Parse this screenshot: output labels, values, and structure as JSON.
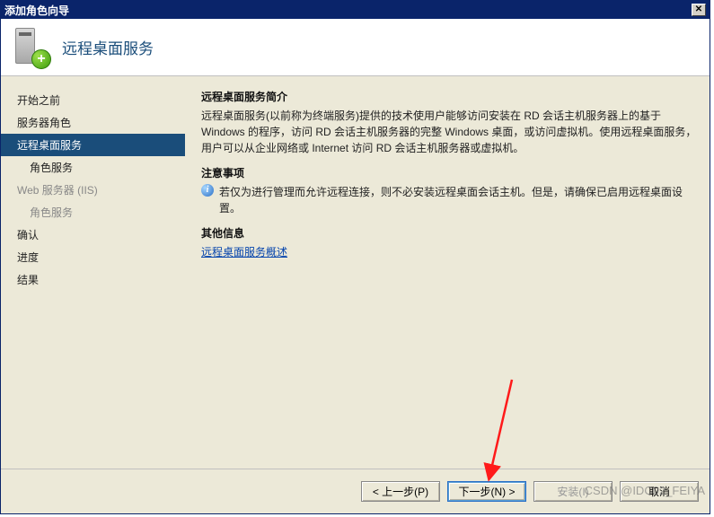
{
  "window": {
    "title": "添加角色向导"
  },
  "header": {
    "title": "远程桌面服务"
  },
  "sidebar": {
    "items": [
      {
        "label": "开始之前"
      },
      {
        "label": "服务器角色"
      },
      {
        "label": "远程桌面服务",
        "selected": true
      },
      {
        "label": "角色服务",
        "indent": true
      },
      {
        "label": "Web 服务器 (IIS)",
        "dim": true
      },
      {
        "label": "角色服务",
        "indent": true,
        "dim": true
      },
      {
        "label": "确认"
      },
      {
        "label": "进度"
      },
      {
        "label": "结果"
      }
    ]
  },
  "content": {
    "intro_heading": "远程桌面服务简介",
    "intro_body": "远程桌面服务(以前称为终端服务)提供的技术使用户能够访问安装在 RD 会话主机服务器上的基于 Windows 的程序，访问 RD 会话主机服务器的完整 Windows 桌面，或访问虚拟机。使用远程桌面服务，用户可以从企业网络或 Internet 访问 RD 会话主机服务器或虚拟机。",
    "notes_heading": "注意事项",
    "notes_body": "若仅为进行管理而允许远程连接，则不必安装远程桌面会话主机。但是，请确保已启用远程桌面设置。",
    "other_heading": "其他信息",
    "link_text": "远程桌面服务概述"
  },
  "buttons": {
    "back": "< 上一步(P)",
    "next": "下一步(N) >",
    "install": "安装(I)",
    "cancel": "取消"
  },
  "watermark": "CSDN @IDC02_FEIYA"
}
